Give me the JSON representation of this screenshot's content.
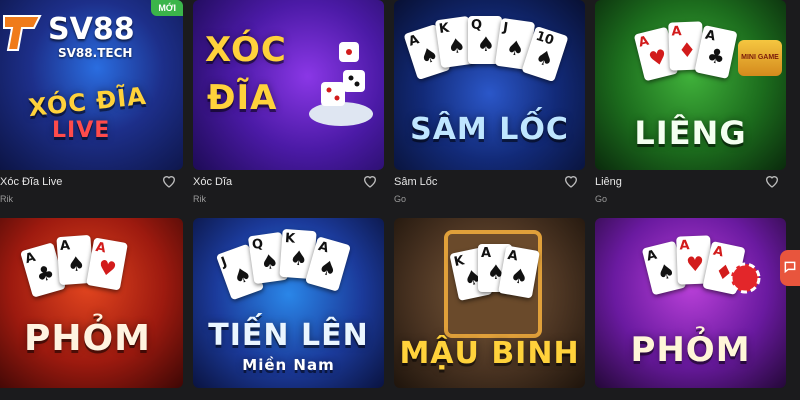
{
  "brand": {
    "logo_text": "SV88",
    "logo_sub": "SV88.TECH"
  },
  "badge_new": "MỚI",
  "cards": [
    {
      "name": "Xóc Đĩa Live",
      "provider": "Rik",
      "art_title": "XÓC ĐĨA",
      "art_sub": "LIVE"
    },
    {
      "name": "Xóc Dĩa",
      "provider": "Rik",
      "art_title": "XÓC",
      "art_sub": "ĐĨA"
    },
    {
      "name": "Sâm Lốc",
      "provider": "Go",
      "art_title": "SÂM LỐC",
      "art_sub": ""
    },
    {
      "name": "Liêng",
      "provider": "Go",
      "art_title": "LIÊNG",
      "art_sub": "",
      "mini_game": "MINI GAME"
    },
    {
      "name": "",
      "provider": "",
      "art_title": "PHỎM",
      "art_sub": ""
    },
    {
      "name": "",
      "provider": "",
      "art_title": "TIẾN LÊN",
      "art_sub": "Miền Nam"
    },
    {
      "name": "",
      "provider": "",
      "art_title": "MẬU BINH",
      "art_sub": ""
    },
    {
      "name": "",
      "provider": "",
      "art_title": "PHỎM",
      "art_sub": ""
    }
  ],
  "colors": {
    "background": "#1b1b1d",
    "new_badge": "#3bb54a",
    "chat_button": "#e8553d",
    "text_primary": "#e6e6e6",
    "text_secondary": "#9a9a9a"
  },
  "icons": {
    "favorite": "heart-outline-icon",
    "chat": "chat-bubble-icon"
  }
}
